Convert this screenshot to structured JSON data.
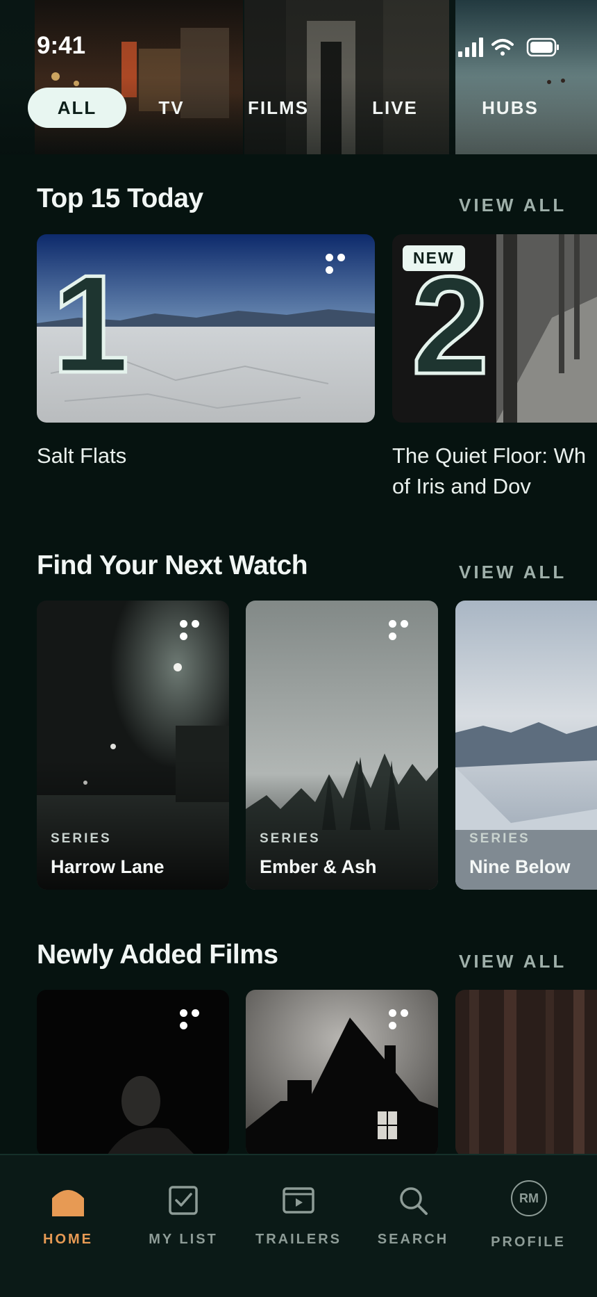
{
  "status_bar": {
    "time": "9:41"
  },
  "nav_tabs": [
    {
      "label": "ALL",
      "active": true
    },
    {
      "label": "TV",
      "active": false
    },
    {
      "label": "FILMS",
      "active": false
    },
    {
      "label": "LIVE",
      "active": false
    },
    {
      "label": "HUBS",
      "active": false
    }
  ],
  "top15": {
    "title": "Top 15 Today",
    "view_all": "VIEW ALL",
    "items": [
      {
        "rank": "1",
        "title": "Salt Flats"
      },
      {
        "rank": "2",
        "badge": "NEW",
        "title_line1": "The Quiet Floor: Wh",
        "title_line2": "of Iris and Dov"
      }
    ]
  },
  "next_watch": {
    "title": "Find Your Next Watch",
    "view_all": "VIEW ALL",
    "items": [
      {
        "kind": "SERIES",
        "title": "Harrow Lane"
      },
      {
        "kind": "SERIES",
        "title": "Ember & Ash"
      },
      {
        "kind": "SERIES",
        "title": "Nine Below"
      }
    ]
  },
  "new_films": {
    "title": "Newly Added Films",
    "view_all": "VIEW ALL"
  },
  "bottom_nav": [
    {
      "label": "HOME",
      "icon": "home-icon",
      "active": true
    },
    {
      "label": "MY LIST",
      "icon": "checkbox-icon",
      "active": false
    },
    {
      "label": "TRAILERS",
      "icon": "play-box-icon",
      "active": false
    },
    {
      "label": "SEARCH",
      "icon": "search-icon",
      "active": false
    },
    {
      "label": "PROFILE",
      "icon": "avatar-icon",
      "avatar_initials": "RM",
      "active": false
    }
  ],
  "colors": {
    "background": "#061310",
    "accent_active_tab": "#e8f6f1",
    "active_nav": "#e79a54",
    "inactive_nav": "#8e9c97"
  }
}
